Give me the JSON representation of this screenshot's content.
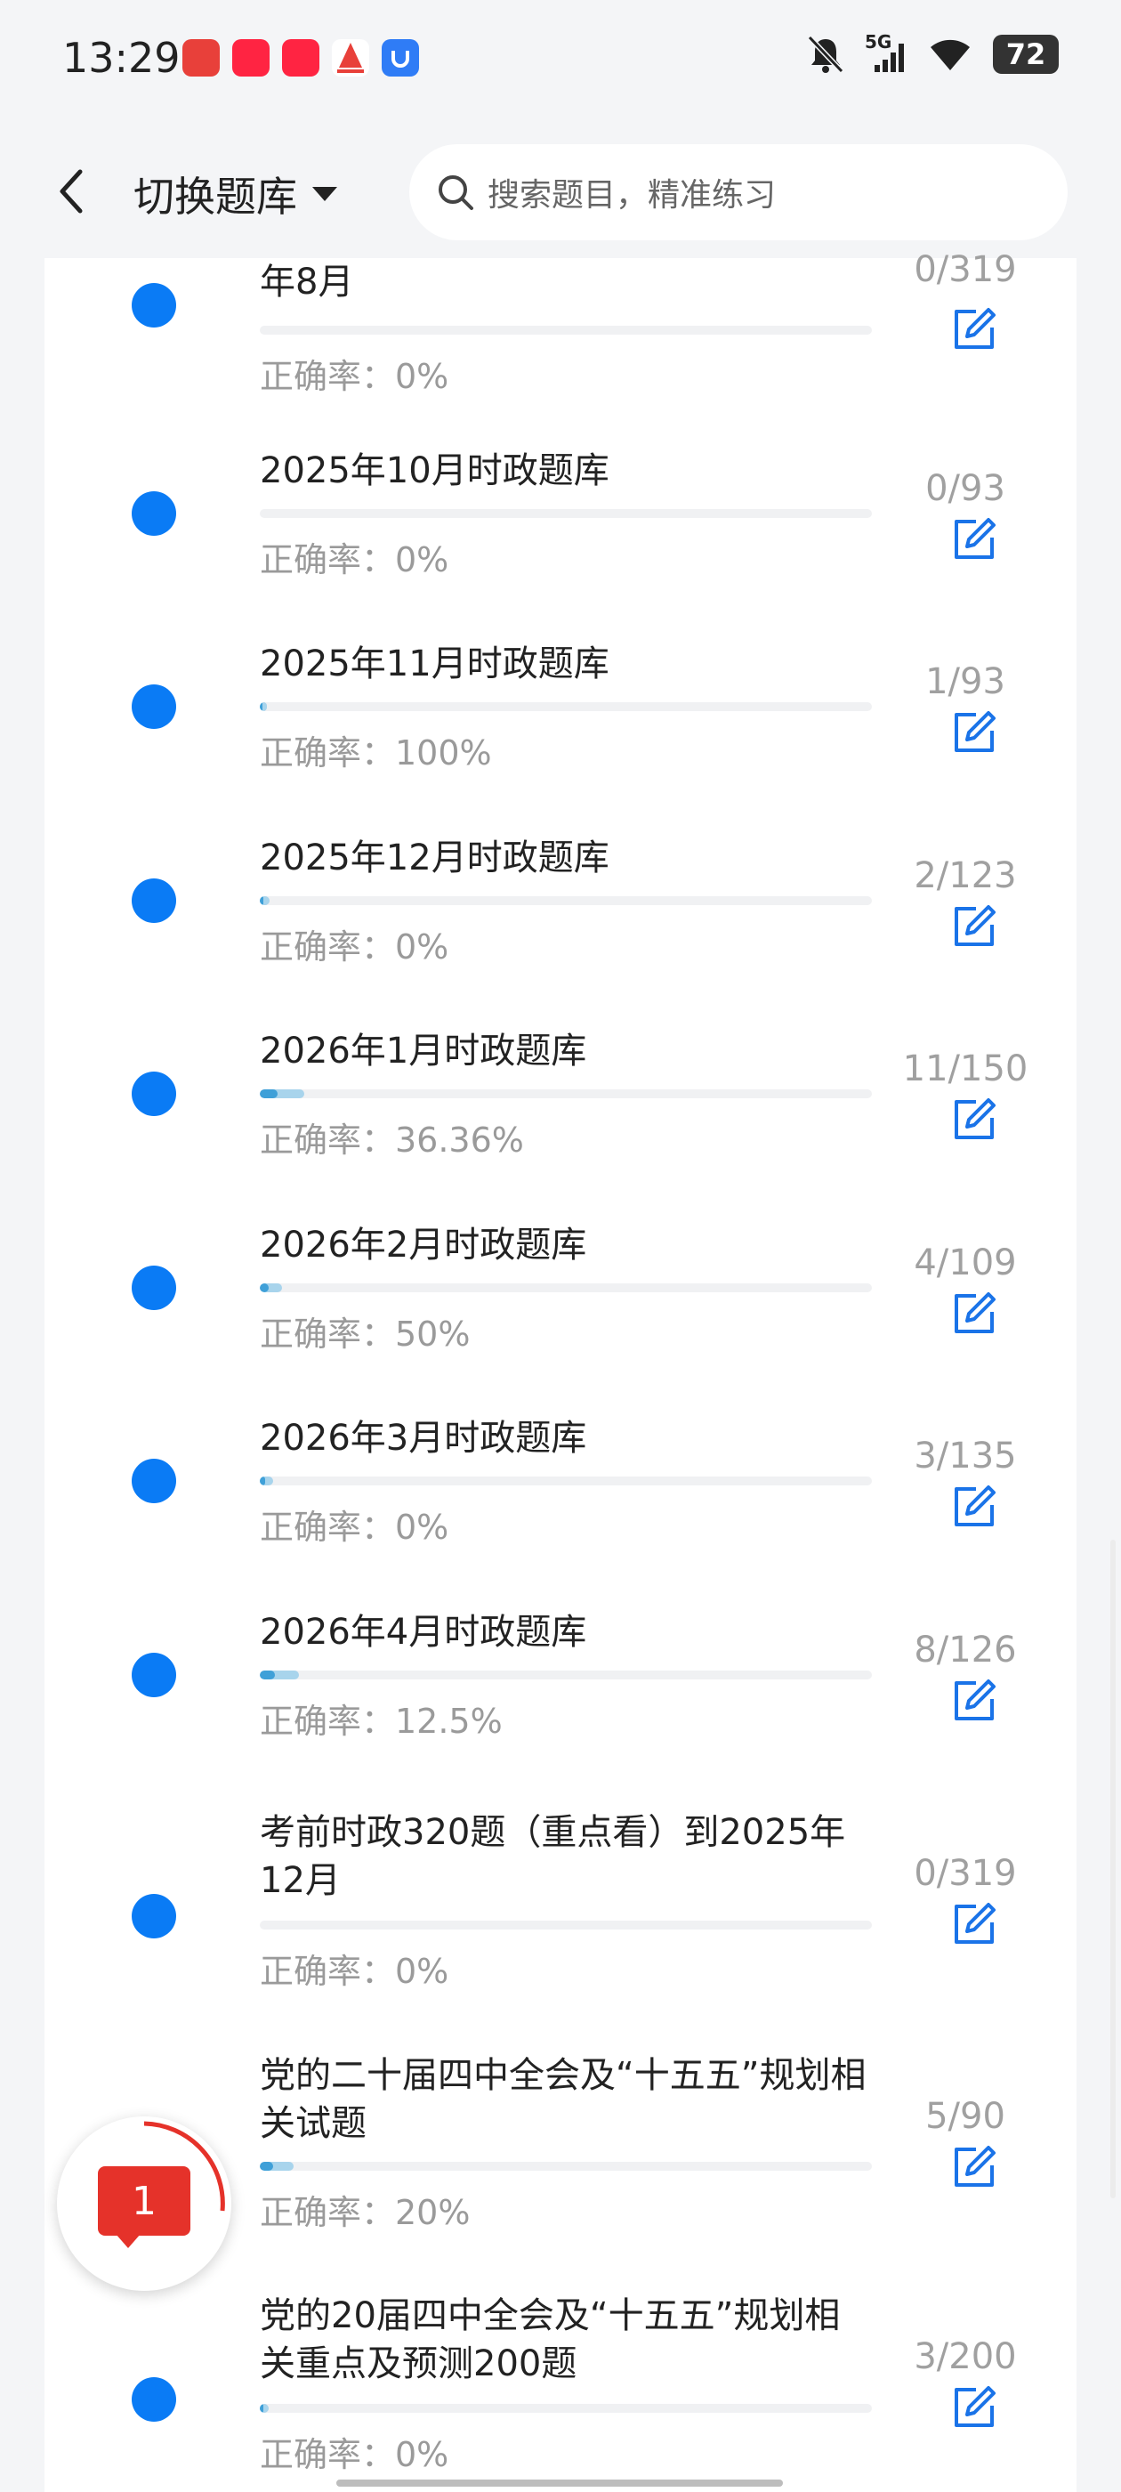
{
  "status_bar": {
    "time": "13:29",
    "network": "5G",
    "battery": "72",
    "app_icons": [
      "app-icon-red-heart",
      "xiaohongshu-icon",
      "xiaohongshu-icon",
      "sail-app-icon",
      "blue-shield-app-icon"
    ]
  },
  "header": {
    "switch_label": "切换题库",
    "search_placeholder": "搜索题目，精准练习"
  },
  "items": [
    {
      "title": "年8月",
      "count": "0/319",
      "accuracy": "正确率：0%",
      "progress": 0
    },
    {
      "title": "2025年10月时政题库",
      "count": "0/93",
      "accuracy": "正确率：0%",
      "progress": 0
    },
    {
      "title": "2025年11月时政题库",
      "count": "1/93",
      "accuracy": "正确率：100%",
      "progress": 0.0108
    },
    {
      "title": "2025年12月时政题库",
      "count": "2/123",
      "accuracy": "正确率：0%",
      "progress": 0.0163
    },
    {
      "title": "2026年1月时政题库",
      "count": "11/150",
      "accuracy": "正确率：36.36%",
      "progress": 0.0733
    },
    {
      "title": "2026年2月时政题库",
      "count": "4/109",
      "accuracy": "正确率：50%",
      "progress": 0.0367
    },
    {
      "title": "2026年3月时政题库",
      "count": "3/135",
      "accuracy": "正确率：0%",
      "progress": 0.0222
    },
    {
      "title": "2026年4月时政题库",
      "count": "8/126",
      "accuracy": "正确率：12.5%",
      "progress": 0.0635
    },
    {
      "title": "考前时政320题（重点看）到2025年12月",
      "count": "0/319",
      "accuracy": "正确率：0%",
      "progress": 0
    },
    {
      "title": "党的二十届四中全会及“十五五”规划相关试题",
      "count": "5/90",
      "accuracy": "正确率：20%",
      "progress": 0.0556
    },
    {
      "title": "党的20届四中全会及“十五五”规划相关重点及预测200题",
      "count": "3/200",
      "accuracy": "正确率：0%",
      "progress": 0.015
    }
  ],
  "float_badge": {
    "count": "1"
  },
  "colors": {
    "accent": "#0a7bf5",
    "badge": "#e5322a"
  }
}
